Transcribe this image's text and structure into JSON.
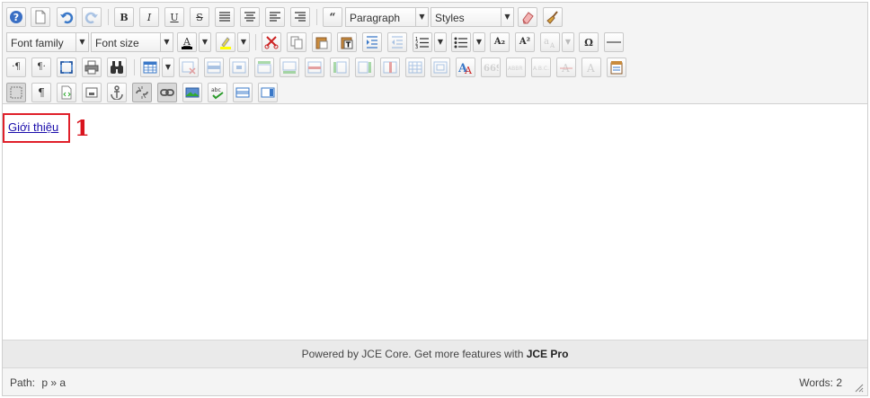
{
  "toolbar": {
    "format_select": "Paragraph",
    "styles_select": "Styles",
    "font_family_select": "Font family",
    "font_size_select": "Font size",
    "bold_label": "B",
    "italic_label": "I",
    "underline_label": "U",
    "strike_label": "S",
    "blockquote_label": "“",
    "ltr_label": "·¶",
    "rtl_label": "¶·",
    "pilcrow_label": "¶",
    "charmap_label": "Ω",
    "subscript_label": "A₂",
    "superscript_label": "A²",
    "font_color": "#000000",
    "highlight_color": "#ffff00"
  },
  "content": {
    "link_text": "Giới thiệu",
    "annotation_marker": "1"
  },
  "footer": {
    "powered_text": "Powered by JCE Core. Get more features with",
    "powered_pro": "JCE Pro"
  },
  "status": {
    "path_label": "Path:",
    "path_value": "p » a",
    "words": "Words: 2"
  },
  "colors": {
    "annotation_red": "#d9141e",
    "link_blue": "#1a0dab"
  }
}
